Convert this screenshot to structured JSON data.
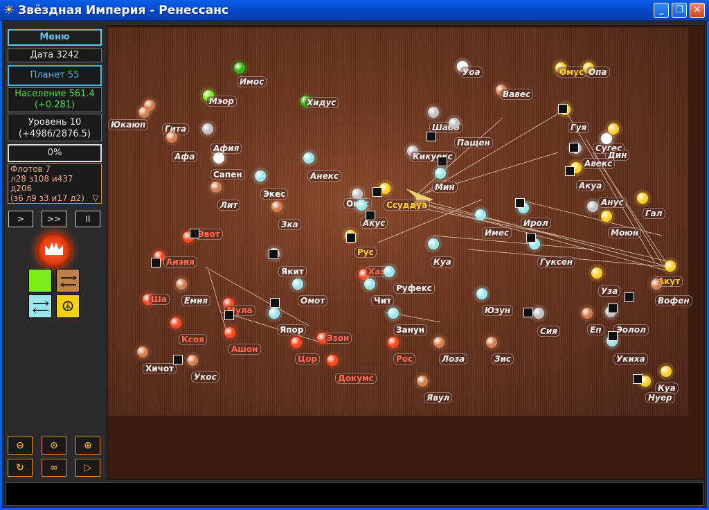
{
  "window": {
    "title": "Звёздная Империя - Ренессанс",
    "icon": "sun-icon",
    "buttons": {
      "minimize": "minimize-icon",
      "maximize": "restore-icon",
      "close": "close-icon"
    }
  },
  "sidebar": {
    "menu_label": "Меню",
    "date": "Дата 3242",
    "planets": "Планет 55",
    "population_line1": "Население 561.4",
    "population_line2": "(+0.281)",
    "level_line1": "Уровень 10",
    "level_line2": "(+4986/2876.5)",
    "progress": "0%",
    "progress_value": 0,
    "fleets": {
      "line1": "Флотов 7",
      "line2": "л28 з108 и437",
      "line3": "д206",
      "line4": "(з6 л9 з3 и17 д2)"
    },
    "speed_buttons": [
      ">",
      ">>",
      "II"
    ],
    "emblem": "crown-icon",
    "tiles": [
      {
        "name": "green-tile",
        "color": "#7aee1a"
      },
      {
        "name": "trade-arrows-tile",
        "color": "#c0804a"
      },
      {
        "name": "swap-arrows-tile",
        "color": "#9ae6ec"
      },
      {
        "name": "peace-tile",
        "color": "#f4d010"
      }
    ],
    "zoom_buttons": [
      "zoom-out-icon",
      "zoom-fit-icon",
      "zoom-in-icon",
      "refresh-icon",
      "infinity-icon",
      "play-icon"
    ]
  },
  "colors": {
    "accent_blue": "#42b8e4",
    "population_green": "#3ee03e",
    "own_yellow": "#ffd028",
    "enemy_red": "#ff6a4a",
    "fleet_orange": "#f0a888"
  },
  "map": {
    "planets": [
      {
        "label": "Имос",
        "style": ""
      },
      {
        "label": "Уоа",
        "style": ""
      },
      {
        "label": "Омус",
        "style": "own"
      },
      {
        "label": "Опа",
        "style": ""
      },
      {
        "label": "Мэор",
        "style": ""
      },
      {
        "label": "Вавес",
        "style": ""
      },
      {
        "label": "Хидус",
        "style": ""
      },
      {
        "label": "Юкаюп",
        "style": ""
      },
      {
        "label": "Гита",
        "style": ""
      },
      {
        "label": "Шабо",
        "style": ""
      },
      {
        "label": "Гуя",
        "style": ""
      },
      {
        "label": "Пащен",
        "style": ""
      },
      {
        "label": "Сугес",
        "style": ""
      },
      {
        "label": "Афия",
        "style": ""
      },
      {
        "label": "Афа",
        "style": ""
      },
      {
        "label": "Кикуекс",
        "style": ""
      },
      {
        "label": "Дин",
        "style": ""
      },
      {
        "label": "Сапен",
        "style": "white"
      },
      {
        "label": "Анекс",
        "style": ""
      },
      {
        "label": "Авекс",
        "style": ""
      },
      {
        "label": "Экес",
        "style": "white"
      },
      {
        "label": "Акуа",
        "style": ""
      },
      {
        "label": "Мин",
        "style": ""
      },
      {
        "label": "Лит",
        "style": ""
      },
      {
        "label": "Овос",
        "style": "white"
      },
      {
        "label": "Ссуддуа",
        "style": "own"
      },
      {
        "label": "Акус",
        "style": ""
      },
      {
        "label": "Гал",
        "style": ""
      },
      {
        "label": "Зка",
        "style": ""
      },
      {
        "label": "Эвот",
        "style": "red"
      },
      {
        "label": "Имес",
        "style": ""
      },
      {
        "label": "Ирол",
        "style": ""
      },
      {
        "label": "Моюн",
        "style": ""
      },
      {
        "label": "Анус",
        "style": ""
      },
      {
        "label": "Рус",
        "style": "own"
      },
      {
        "label": "Аиэия",
        "style": "red"
      },
      {
        "label": "Якит",
        "style": "white"
      },
      {
        "label": "Куа",
        "style": ""
      },
      {
        "label": "Гуксен",
        "style": ""
      },
      {
        "label": "Хазр",
        "style": "red"
      },
      {
        "label": "Руфекс",
        "style": "white"
      },
      {
        "label": "Акут",
        "style": "own"
      },
      {
        "label": "Уза",
        "style": ""
      },
      {
        "label": "Вофен",
        "style": ""
      },
      {
        "label": "Ша",
        "style": "red"
      },
      {
        "label": "Емия",
        "style": ""
      },
      {
        "label": "Мула",
        "style": "red"
      },
      {
        "label": "Омот",
        "style": ""
      },
      {
        "label": "Чит",
        "style": "white"
      },
      {
        "label": "Юзун",
        "style": ""
      },
      {
        "label": "Ксоя",
        "style": "red"
      },
      {
        "label": "Япор",
        "style": "white"
      },
      {
        "label": "Занун",
        "style": "white"
      },
      {
        "label": "Сия",
        "style": ""
      },
      {
        "label": "Еп",
        "style": ""
      },
      {
        "label": "Эолол",
        "style": ""
      },
      {
        "label": "Ашон",
        "style": "red"
      },
      {
        "label": "Эзон",
        "style": "red"
      },
      {
        "label": "Хичот",
        "style": "white"
      },
      {
        "label": "Укос",
        "style": ""
      },
      {
        "label": "Цор",
        "style": "red"
      },
      {
        "label": "Рос",
        "style": "red"
      },
      {
        "label": "Лоза",
        "style": ""
      },
      {
        "label": "Зис",
        "style": ""
      },
      {
        "label": "Укиха",
        "style": ""
      },
      {
        "label": "Докумс",
        "style": "red"
      },
      {
        "label": "Куа",
        "style": ""
      },
      {
        "label": "Нуер",
        "style": ""
      },
      {
        "label": "Явул",
        "style": ""
      }
    ]
  }
}
